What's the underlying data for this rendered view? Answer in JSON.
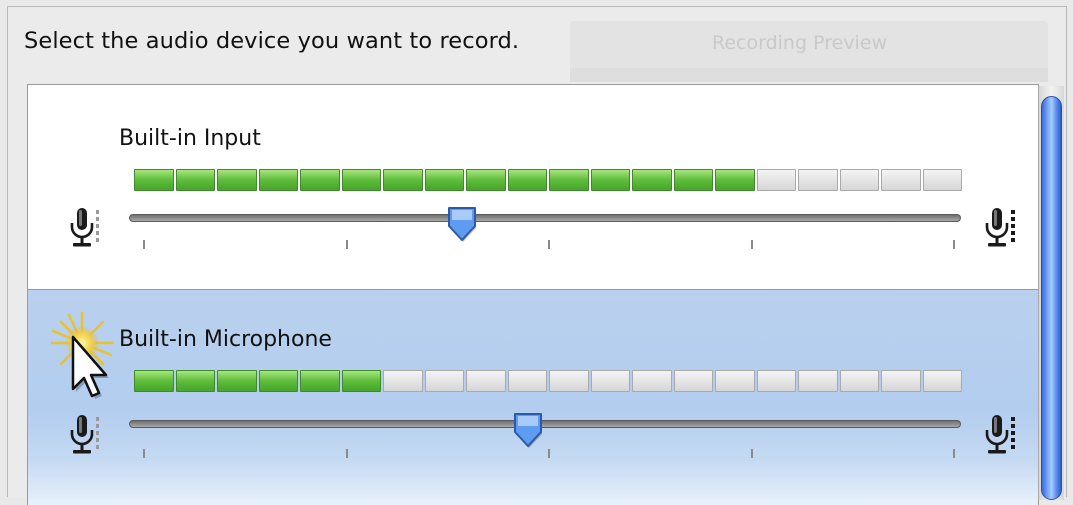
{
  "dialog": {
    "instruction": "Select the audio device you want to record.",
    "background_title": "Recording Preview"
  },
  "devices": [
    {
      "label": "Built-in Input",
      "selected": false,
      "meter_segments_total": 20,
      "meter_segments_lit": 15,
      "volume_fraction": 0.4
    },
    {
      "label": "Built-in Microphone",
      "selected": true,
      "meter_segments_total": 20,
      "meter_segments_lit": 6,
      "volume_fraction": 0.48
    }
  ],
  "slider_tick_count": 5,
  "icons": {
    "volume_low": "microphone-low-icon",
    "volume_high": "microphone-high-icon",
    "cursor": "arrow-cursor-icon"
  },
  "colors": {
    "meter_on": "#5ebd3b",
    "meter_off": "#e4e4e4",
    "selection": "#b3cdef",
    "scroll_thumb": "#5d8ff0",
    "knob": "#4f8de8"
  }
}
